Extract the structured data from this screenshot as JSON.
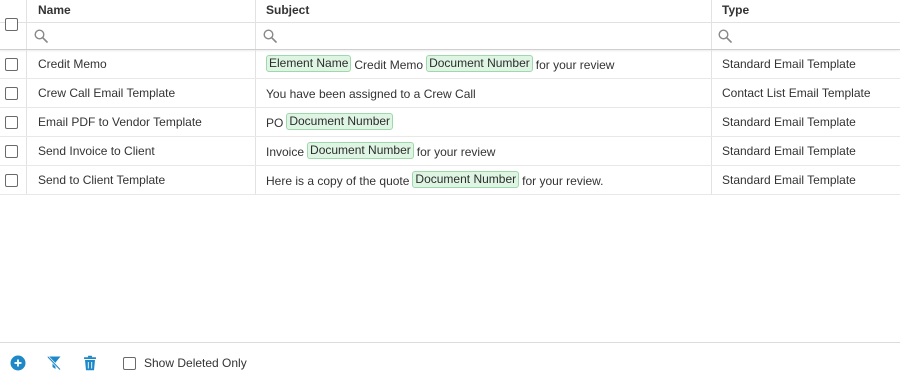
{
  "columns": {
    "name": "Name",
    "subject": "Subject",
    "type": "Type"
  },
  "rows": [
    {
      "name": "Credit Memo",
      "subject": [
        {
          "t": "tag",
          "v": "Element Name"
        },
        {
          "t": "text",
          "v": "Credit Memo"
        },
        {
          "t": "tag",
          "v": "Document Number"
        },
        {
          "t": "text",
          "v": "for your review"
        }
      ],
      "type": "Standard Email Template"
    },
    {
      "name": "Crew Call Email Template",
      "subject": [
        {
          "t": "text",
          "v": "You have been assigned to a Crew Call"
        }
      ],
      "type": "Contact List Email Template"
    },
    {
      "name": "Email PDF to Vendor Template",
      "subject": [
        {
          "t": "text",
          "v": "PO"
        },
        {
          "t": "tag",
          "v": "Document Number"
        }
      ],
      "type": "Standard Email Template"
    },
    {
      "name": "Send Invoice to Client",
      "subject": [
        {
          "t": "text",
          "v": "Invoice"
        },
        {
          "t": "tag",
          "v": "Document Number"
        },
        {
          "t": "text",
          "v": "for your review"
        }
      ],
      "type": "Standard Email Template"
    },
    {
      "name": "Send to Client Template",
      "subject": [
        {
          "t": "text",
          "v": "Here is a copy of the quote"
        },
        {
          "t": "tag",
          "v": "Document Number"
        },
        {
          "t": "text",
          "v": "for your review."
        }
      ],
      "type": "Standard Email Template"
    }
  ],
  "footer": {
    "show_deleted_label": "Show Deleted Only",
    "icons": [
      "add-circle-icon",
      "clear-filter-icon",
      "trash-icon"
    ]
  },
  "colors": {
    "accent_blue": "#1e88c8",
    "tag_bg": "#dff5e3",
    "tag_border": "#9fd8ad"
  }
}
